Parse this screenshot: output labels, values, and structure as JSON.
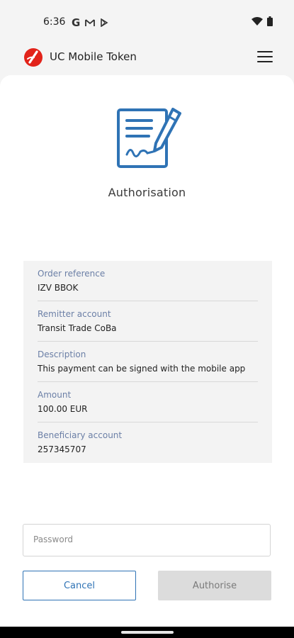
{
  "status_bar": {
    "time": "6:36",
    "left_icons": [
      "google-icon",
      "gmail-icon",
      "play-store-icon"
    ],
    "right_icons": [
      "wifi-icon",
      "battery-icon"
    ]
  },
  "app_bar": {
    "title": "UC Mobile Token",
    "logo": "unicredit-logo",
    "menu_icon": "hamburger-menu-icon",
    "brand_color": "#e2231a"
  },
  "screen": {
    "icon": "sign-document-icon",
    "title": "Authorisation",
    "accent_color": "#2f73b5"
  },
  "details": [
    {
      "label": "Order reference",
      "value": "IZV BBOK"
    },
    {
      "label": "Remitter account",
      "value": "Transit Trade CoBa"
    },
    {
      "label": "Description",
      "value": "This payment can be signed with the mobile app"
    },
    {
      "label": "Amount",
      "value": "100.00 EUR"
    },
    {
      "label": "Beneficiary account",
      "value": "257345707"
    }
  ],
  "password": {
    "placeholder": "Password",
    "value": ""
  },
  "buttons": {
    "cancel_label": "Cancel",
    "authorise_label": "Authorise"
  }
}
